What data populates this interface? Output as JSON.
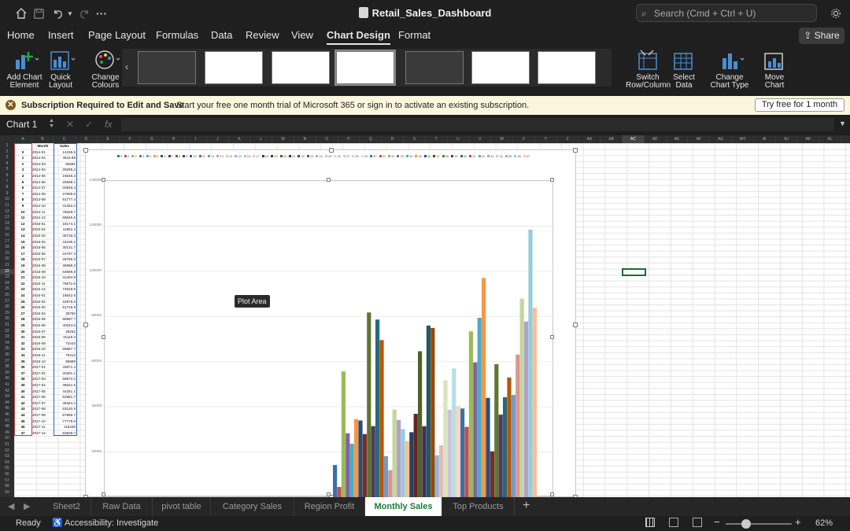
{
  "titlebar": {
    "doc_title": "Retail_Sales_Dashboard",
    "search_placeholder": "Search (Cmd + Ctrl + U)"
  },
  "tabs": [
    "Home",
    "Insert",
    "Page Layout",
    "Formulas",
    "Data",
    "Review",
    "View",
    "Chart Design",
    "Format"
  ],
  "active_tab": "Chart Design",
  "share_label": "Share",
  "ribbon": {
    "add_chart_element": [
      "Add Chart",
      "Element"
    ],
    "quick_layout": [
      "Quick",
      "Layout"
    ],
    "change_colours": [
      "Change",
      "Colours"
    ],
    "switch_row_column": [
      "Switch",
      "Row/Column"
    ],
    "select_data": [
      "Select",
      "Data"
    ],
    "change_chart_type": [
      "Change",
      "Chart Type"
    ],
    "move_chart": [
      "Move",
      "Chart"
    ]
  },
  "message_bar": {
    "title": "Subscription Required to Edit and Save",
    "text": "Start your free one month trial of Microsoft 365 or sign in to activate an existing subscription.",
    "button": "Try free for 1 month"
  },
  "formula_bar": {
    "name_box": "Chart 1",
    "fx": "fx"
  },
  "columns": [
    "A",
    "B",
    "C",
    "D",
    "E",
    "F",
    "G",
    "H",
    "I",
    "J",
    "K",
    "L",
    "M",
    "N",
    "O",
    "P",
    "Q",
    "R",
    "S",
    "T",
    "U",
    "V",
    "W",
    "X",
    "Y",
    "Z",
    "AA",
    "AB",
    "AC",
    "AD",
    "AE",
    "AF",
    "AG",
    "AH",
    "AI",
    "AJ",
    "AK",
    "AL"
  ],
  "data_header": {
    "a": "",
    "b": "Month",
    "c": "Sales"
  },
  "data_rows": [
    [
      "0",
      "2014-01",
      "14236.9"
    ],
    [
      "1",
      "2014-02",
      "4519.89"
    ],
    [
      "2",
      "2014-03",
      "55691"
    ],
    [
      "3",
      "2014-04",
      "28295.3"
    ],
    [
      "4",
      "2014-05",
      "23648.3"
    ],
    [
      "5",
      "2014-06",
      "34595.1"
    ],
    [
      "6",
      "2014-07",
      "33946.4"
    ],
    [
      "7",
      "2014-08",
      "27909.5"
    ],
    [
      "8",
      "2014-09",
      "81777.4"
    ],
    [
      "9",
      "2014-10",
      "31453.4"
    ],
    [
      "10",
      "2014-11",
      "78628.7"
    ],
    [
      "11",
      "2014-12",
      "69545.6"
    ],
    [
      "12",
      "2015-01",
      "18174.1"
    ],
    [
      "13",
      "2015-02",
      "11951.4"
    ],
    [
      "14",
      "2015-03",
      "38726.3"
    ],
    [
      "15",
      "2015-04",
      "34195.2"
    ],
    [
      "16",
      "2015-05",
      "30131.7"
    ],
    [
      "17",
      "2015-06",
      "24797.3"
    ],
    [
      "18",
      "2015-07",
      "28765.3"
    ],
    [
      "19",
      "2015-08",
      "36898.3"
    ],
    [
      "20",
      "2015-09",
      "64595.9"
    ],
    [
      "21",
      "2015-10",
      "31404.9"
    ],
    [
      "22",
      "2015-11",
      "75972.6"
    ],
    [
      "23",
      "2015-12",
      "74919.5"
    ],
    [
      "24",
      "2016-01",
      "18542.5"
    ],
    [
      "25",
      "2016-02",
      "22978.8"
    ],
    [
      "26",
      "2016-03",
      "51715.9"
    ],
    [
      "27",
      "2016-04",
      "38750"
    ],
    [
      "28",
      "2016-05",
      "56987.7"
    ],
    [
      "29",
      "2016-06",
      "40344.5"
    ],
    [
      "30",
      "2016-07",
      "39262"
    ],
    [
      "31",
      "2016-08",
      "31115.4"
    ],
    [
      "32",
      "2016-09",
      "73410"
    ],
    [
      "33",
      "2016-10",
      "59687.7"
    ],
    [
      "34",
      "2016-11",
      "79412"
    ],
    [
      "35",
      "2016-12",
      "96999"
    ],
    [
      "36",
      "2017-01",
      "43971.4"
    ],
    [
      "37",
      "2017-02",
      "20301.1"
    ],
    [
      "38",
      "2017-03",
      "58872.4"
    ],
    [
      "39",
      "2017-04",
      "36521.5"
    ],
    [
      "40",
      "2017-05",
      "44261.1"
    ],
    [
      "41",
      "2017-06",
      "52981.7"
    ],
    [
      "42",
      "2017-07",
      "45264.4"
    ],
    [
      "43",
      "2017-08",
      "63120.9"
    ],
    [
      "44",
      "2017-09",
      "87866.7"
    ],
    [
      "45",
      "2017-10",
      "77776.9"
    ],
    [
      "46",
      "2017-11",
      "118448"
    ],
    [
      "47",
      "2017-12",
      "83829.7"
    ]
  ],
  "chart_data": {
    "type": "bar",
    "series_names": [
      "0",
      "1",
      "2",
      "3",
      "4",
      "5",
      "6",
      "7",
      "8",
      "9",
      "10",
      "11",
      "12",
      "13",
      "14",
      "15",
      "16",
      "17",
      "18",
      "19",
      "20",
      "21",
      "22",
      "23",
      "24",
      "25",
      "26",
      "27",
      "28",
      "29",
      "30",
      "31",
      "32",
      "33",
      "34",
      "35",
      "36",
      "37",
      "38",
      "39",
      "40",
      "41",
      "42",
      "43",
      "44",
      "45",
      "46",
      "47"
    ],
    "values": [
      14236.9,
      4519.89,
      55691,
      28295.3,
      23648.3,
      34595.1,
      33946.4,
      27909.5,
      81777.4,
      31453.4,
      78628.7,
      69545.6,
      18174.1,
      11951.4,
      38726.3,
      34195.2,
      30131.7,
      24797.3,
      28765.3,
      36898.3,
      64595.9,
      31404.9,
      75972.6,
      74919.5,
      18542.5,
      22978.8,
      51715.9,
      38750,
      56987.7,
      40344.5,
      39262,
      31115.4,
      73410,
      59687.7,
      79412,
      96999,
      43971.4,
      20301.1,
      58872.4,
      36521.5,
      44261.1,
      52981.7,
      45264.4,
      63120.9,
      87866.7,
      77776.9,
      118448,
      83829.7
    ],
    "y_ticks": [
      "140000",
      "120000",
      "100000",
      "80000",
      "60000",
      "40000",
      "20000"
    ],
    "ylim": [
      0,
      140000
    ],
    "colors": [
      "#3a6fb0",
      "#c0504d",
      "#9bbb59",
      "#8064a2",
      "#4bacc6",
      "#f79646",
      "#2c4d75",
      "#772c2a",
      "#5f7530",
      "#4d3b62",
      "#276a7c",
      "#b65708",
      "#729aca",
      "#d99694",
      "#c3d69b",
      "#b2a1c7",
      "#93cddd",
      "#fac090",
      "#254061",
      "#632523",
      "#4f6228",
      "#3f3151",
      "#215968",
      "#984807",
      "#95b3d7",
      "#e6b9b8",
      "#d7e4bd",
      "#ccc1da",
      "#b7dde8",
      "#fcd5b5"
    ],
    "legend_position": "top",
    "grid": true,
    "tooltip": "Plot Area"
  },
  "sheets": [
    "Sheet2",
    "Raw Data",
    "pivot table",
    "Category Sales",
    "Region Profit",
    "Monthly Sales",
    "Top Products"
  ],
  "active_sheet": "Monthly Sales",
  "status": {
    "ready": "Ready",
    "accessibility": "Accessibility: Investigate",
    "zoom": "62%"
  }
}
